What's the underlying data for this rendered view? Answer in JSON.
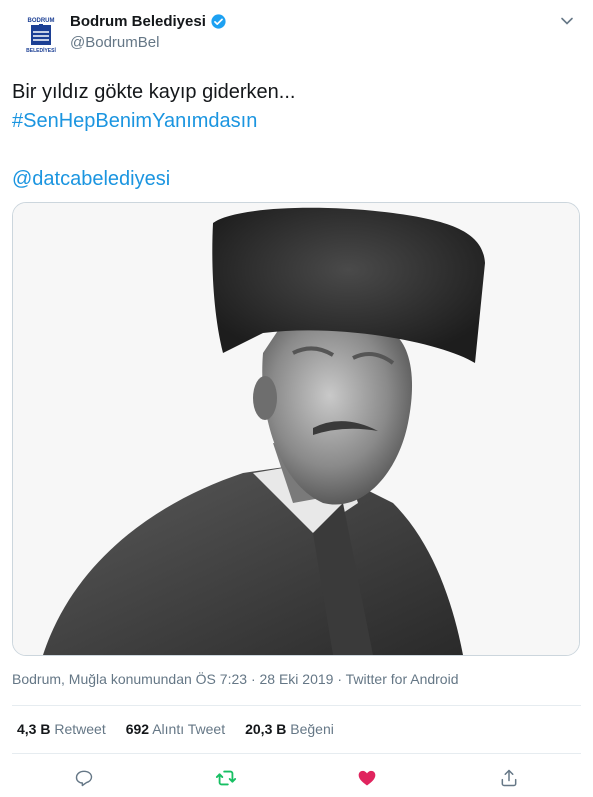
{
  "author": {
    "name": "Bodrum Belediyesi",
    "handle": "@BodrumBel",
    "logo_text_top": "BODRUM",
    "logo_text_bottom": "BELEDİYESİ"
  },
  "tweet": {
    "line1": "Bir yıldız gökte kayıp giderken...",
    "hashtag": "#SenHepBenimYanımdasın",
    "mention": "@datcabelediyesi"
  },
  "meta": {
    "location": "Bodrum, Muğla konumundan",
    "time": "ÖS 7:23",
    "date": "28 Eki 2019",
    "source": "Twitter for Android"
  },
  "stats": [
    {
      "value": "4,3 B",
      "label": "Retweet"
    },
    {
      "value": "692",
      "label": "Alıntı Tweet"
    },
    {
      "value": "20,3 B",
      "label": "Beğeni"
    }
  ],
  "colors": {
    "link": "#1b95e0",
    "retweet": "#17bf63",
    "like": "#e0245e",
    "muted": "#657786"
  },
  "icons": {
    "verified": "verified-badge-icon",
    "chevron": "chevron-down-icon",
    "reply": "reply-icon",
    "retweet": "retweet-icon",
    "like": "heart-icon",
    "share": "share-icon"
  }
}
